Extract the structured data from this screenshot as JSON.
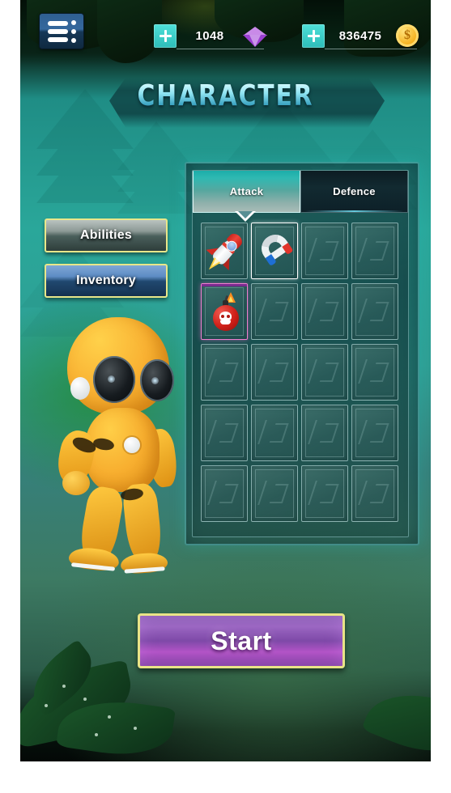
{
  "header": {
    "menu_icon": "hamburger-menu-icon",
    "currencies": [
      {
        "id": "gems",
        "plus_label": "+",
        "amount": "1048",
        "icon": "gem-icon"
      },
      {
        "id": "coins",
        "plus_label": "+",
        "amount": "836475",
        "icon": "coin-icon"
      }
    ]
  },
  "page": {
    "title": "CHARACTER"
  },
  "sidebar": {
    "buttons": [
      {
        "id": "abilities",
        "label": "Abilities"
      },
      {
        "id": "inventory",
        "label": "Inventory"
      }
    ]
  },
  "panel": {
    "tabs": [
      {
        "id": "attack",
        "label": "Attack",
        "active": true
      },
      {
        "id": "defence",
        "label": "Defence",
        "active": false
      }
    ],
    "grid": {
      "columns": 4,
      "rows": 5,
      "slots": [
        {
          "index": 0,
          "item": "rocket-icon",
          "selected": "none"
        },
        {
          "index": 1,
          "item": "magnet-icon",
          "selected": "white"
        },
        {
          "index": 2,
          "item": null,
          "selected": "none"
        },
        {
          "index": 3,
          "item": null,
          "selected": "none"
        },
        {
          "index": 4,
          "item": "bomb-icon",
          "selected": "pink"
        },
        {
          "index": 5,
          "item": null,
          "selected": "none"
        },
        {
          "index": 6,
          "item": null,
          "selected": "none"
        },
        {
          "index": 7,
          "item": null,
          "selected": "none"
        },
        {
          "index": 8,
          "item": null,
          "selected": "none"
        },
        {
          "index": 9,
          "item": null,
          "selected": "none"
        },
        {
          "index": 10,
          "item": null,
          "selected": "none"
        },
        {
          "index": 11,
          "item": null,
          "selected": "none"
        },
        {
          "index": 12,
          "item": null,
          "selected": "none"
        },
        {
          "index": 13,
          "item": null,
          "selected": "none"
        },
        {
          "index": 14,
          "item": null,
          "selected": "none"
        },
        {
          "index": 15,
          "item": null,
          "selected": "none"
        },
        {
          "index": 16,
          "item": null,
          "selected": "none"
        },
        {
          "index": 17,
          "item": null,
          "selected": "none"
        },
        {
          "index": 18,
          "item": null,
          "selected": "none"
        },
        {
          "index": 19,
          "item": null,
          "selected": "none"
        }
      ]
    }
  },
  "character": {
    "name": "yellow-robot-avatar"
  },
  "actions": {
    "start_label": "Start"
  },
  "colors": {
    "accent_cyan": "#2fb9b2",
    "title_cyan": "#8fe4f2",
    "gold_border": "#e9e487",
    "start_purple": "#9a66c1",
    "gem_purple": "#9b3fd0",
    "coin_gold": "#f5b221",
    "inventory_blue": "#5d8cc4",
    "select_pink": "#ef7fd0",
    "background_teal": "#2aa79a"
  }
}
